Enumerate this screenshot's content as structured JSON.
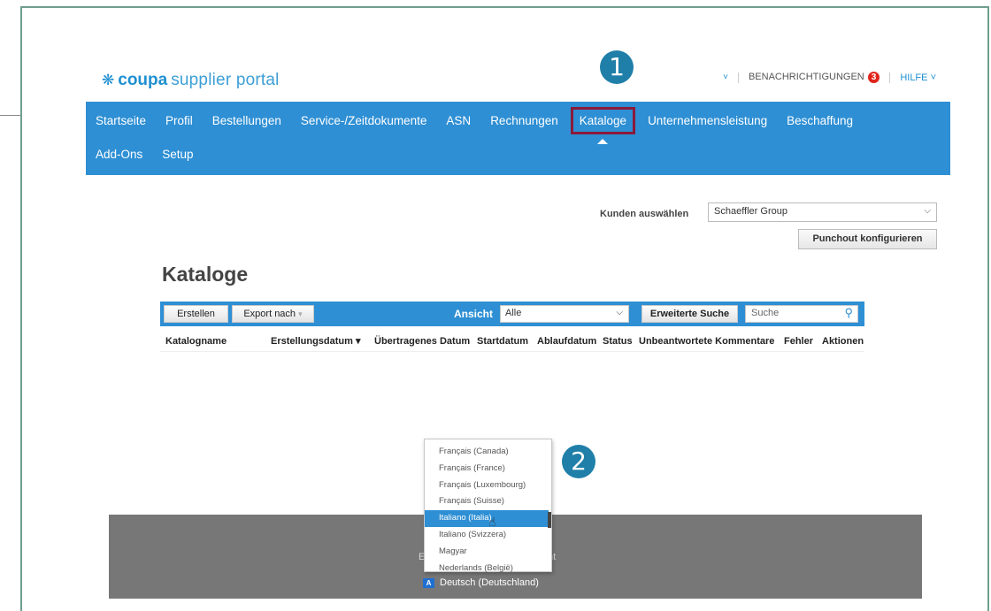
{
  "logo": {
    "mark": "❋",
    "brand": "coupa",
    "rest": "supplier portal"
  },
  "topbar": {
    "chevron": "˅",
    "notifications_label": "BENACHRICHTIGUNGEN",
    "notifications_count": "3",
    "help_label": "HILFE",
    "help_chevron": "˅"
  },
  "callouts": {
    "one": "1",
    "two": "2"
  },
  "nav": {
    "row1": [
      "Startseite",
      "Profil",
      "Bestellungen",
      "Service-/Zeitdokumente",
      "ASN",
      "Rechnungen",
      "Kataloge",
      "Unternehmensleistung",
      "Beschaffung"
    ],
    "row2": [
      "Add-Ons",
      "Setup"
    ],
    "active": "Kataloge",
    "active_outline_color": "#8b1a3a"
  },
  "customer": {
    "label": "Kunden auswählen",
    "selected": "Schaeffler Group",
    "punchout_button": "Punchout konfigurieren"
  },
  "page_title": "Kataloge",
  "toolbar": {
    "create_label": "Erstellen",
    "export_label": "Export nach",
    "export_arrow": "▾",
    "view_label": "Ansicht",
    "view_value": "Alle",
    "advanced_search_label": "Erweiterte Suche",
    "search_placeholder": "Suche"
  },
  "table": {
    "columns": [
      "Katalogname",
      "Erstellungsdatum ▾",
      "Übertragenes Datum",
      "Startdatum",
      "Ablaufdatum",
      "Status",
      "Unbeantwortete Kommentare",
      "Fehler",
      "Aktionen"
    ]
  },
  "footer": {
    "left_fragment": "E",
    "right_fragment": "nt"
  },
  "language": {
    "options": [
      "Français (Canada)",
      "Français (France)",
      "Français (Luxembourg)",
      "Français (Suisse)",
      "Italiano (Italia)",
      "Italiano (Svizzera)",
      "Magyar",
      "Nederlands (België)"
    ],
    "highlighted": "Italiano (Italia)",
    "current": "Deutsch (Deutschland)",
    "flag_text": "A"
  },
  "colors": {
    "primary": "#2e8fd4",
    "footer": "#777777",
    "badge": "#e0241b",
    "callout": "#1f7fa8"
  }
}
